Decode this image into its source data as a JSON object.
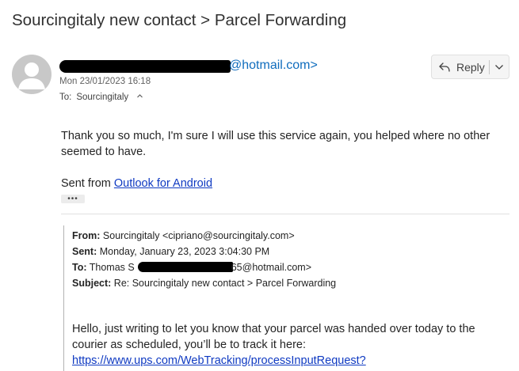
{
  "subject": "Sourcingitaly new contact > Parcel Forwarding",
  "sender": {
    "email_visible": "@hotmail.com>",
    "date": "Mon 23/01/2023 16:18",
    "to_label": "To:",
    "to_name": "Sourcingitaly"
  },
  "actions": {
    "reply_label": "Reply",
    "icons": [
      "reply-arrow-icon",
      "chevron-down-icon"
    ]
  },
  "body": {
    "paragraph": "Thank you so much, I'm sure I will use this service again, you helped where no other seemed to have.",
    "sent_from_prefix": "Sent from ",
    "sent_from_link": "Outlook for Android",
    "ellipsis": "•••"
  },
  "quoted": {
    "from_label": "From:",
    "from_value": "Sourcingitaly <cipriano@sourcingitaly.com>",
    "sent_label": "Sent:",
    "sent_value": "Monday, January 23, 2023 3:04:30 PM",
    "to_label": "To:",
    "to_value_start": "Thomas S",
    "to_value_end": "65@hotmail.com>",
    "subject_label": "Subject:",
    "subject_value": "Re: Sourcingitaly new contact > Parcel Forwarding",
    "body": "Hello, just writing to let you know that your parcel was handed over today to the courier as scheduled, you’ll be to track it here:",
    "link": "https://www.ups.com/WebTracking/processInputRequest?"
  },
  "colors": {
    "link": "#0f3ac2",
    "sender_link": "#0f6cbd",
    "avatar_bg": "#c8c8c8"
  }
}
